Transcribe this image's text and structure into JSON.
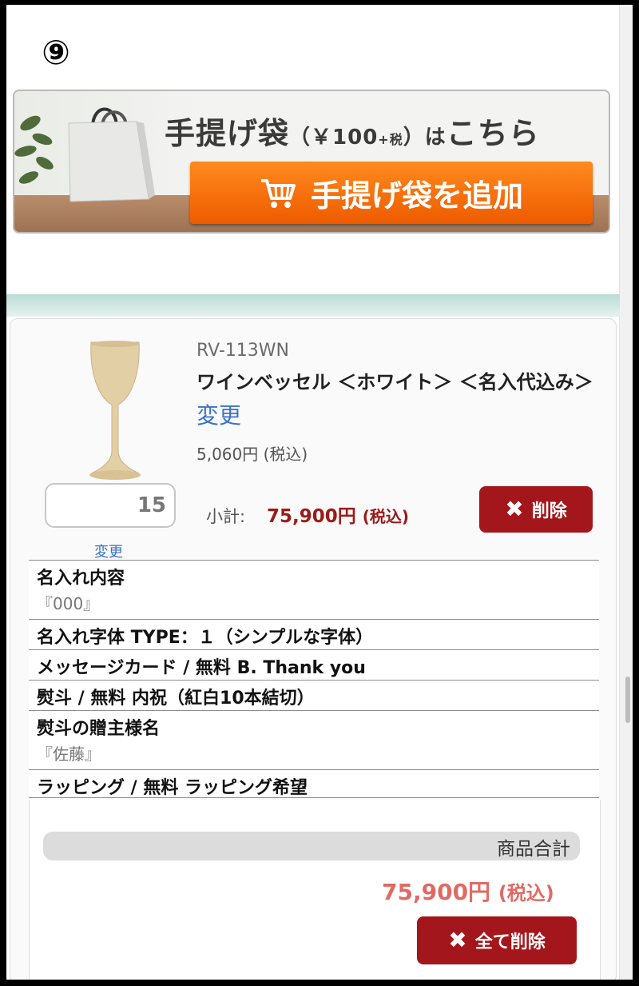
{
  "step_marker": "⑨",
  "banner": {
    "title_main": "手提げ袋",
    "title_price_open": "（￥100",
    "title_price_tax": "+税",
    "title_price_close": "）",
    "title_ha": "は",
    "title_kochira": "こちら",
    "add_button_label": "手提げ袋を追加",
    "add_button_icon": "cart-icon"
  },
  "cart_item": {
    "sku": "RV-113WN",
    "name": "ワインベッセル ＜ホワイト＞ ＜名入代込み＞",
    "change_label": "変更",
    "unit_price": "5,060円 (税込)",
    "quantity": "15",
    "quantity_change_label": "変更",
    "subtotal_label": "小計:",
    "subtotal_amount": "75,900円",
    "subtotal_tax": "(税込)",
    "delete_label": "削除",
    "delete_icon": "close-icon"
  },
  "options": [
    {
      "main": "名入れ内容",
      "sub": "『000』"
    },
    {
      "main": "名入れ字体 TYPE：１（シンプルな字体）"
    },
    {
      "main": "メッセージカード / 無料 B. Thank you"
    },
    {
      "main": "熨斗 / 無料 内祝（紅白10本結切）"
    },
    {
      "main": "熨斗の贈主様名",
      "sub": "『佐藤』"
    },
    {
      "main": "ラッピング / 無料 ラッピング希望"
    }
  ],
  "totals": {
    "label": "商品合計",
    "amount": "75,900円",
    "tax": "(税込)",
    "delete_all_label": "全て削除",
    "delete_all_icon": "close-icon"
  },
  "colors": {
    "accent_orange": "#f07000",
    "delete_red": "#a3161b",
    "price_red": "#9b1b1b",
    "total_red": "#e06a63",
    "link_blue": "#3b72c8"
  }
}
